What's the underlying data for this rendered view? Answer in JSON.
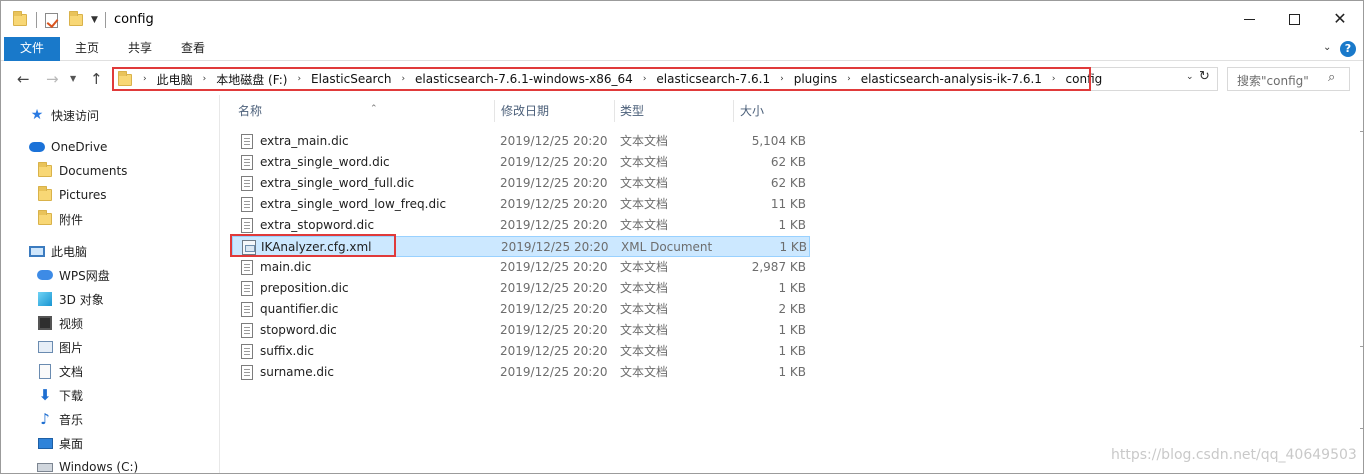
{
  "window": {
    "title": "config"
  },
  "ribbon": {
    "tabs": [
      {
        "label": "文件"
      },
      {
        "label": "主页"
      },
      {
        "label": "共享"
      },
      {
        "label": "查看"
      }
    ],
    "help": "?"
  },
  "address": {
    "breadcrumbs": [
      "此电脑",
      "本地磁盘 (F:)",
      "ElasticSearch",
      "elasticsearch-7.6.1-windows-x86_64",
      "elasticsearch-7.6.1",
      "plugins",
      "elasticsearch-analysis-ik-7.6.1",
      "config"
    ],
    "search_placeholder": "搜索\"config\""
  },
  "nav_pane": {
    "items": [
      {
        "label": "快速访问",
        "icon": "star-icon"
      },
      {
        "label": "OneDrive",
        "icon": "cloud-icon"
      },
      {
        "label": "Documents",
        "icon": "folder-icon"
      },
      {
        "label": "Pictures",
        "icon": "folder-icon"
      },
      {
        "label": "附件",
        "icon": "folder-icon"
      },
      {
        "label": "此电脑",
        "icon": "computer-icon"
      },
      {
        "label": "WPS网盘",
        "icon": "cloud-icon"
      },
      {
        "label": "3D 对象",
        "icon": "cube-icon"
      },
      {
        "label": "视频",
        "icon": "video-icon"
      },
      {
        "label": "图片",
        "icon": "picture-icon"
      },
      {
        "label": "文档",
        "icon": "document-icon"
      },
      {
        "label": "下载",
        "icon": "download-icon"
      },
      {
        "label": "音乐",
        "icon": "music-icon"
      },
      {
        "label": "桌面",
        "icon": "desktop-icon"
      },
      {
        "label": "Windows (C:)",
        "icon": "drive-icon"
      }
    ]
  },
  "columns": {
    "name": "名称",
    "date": "修改日期",
    "type": "类型",
    "size": "大小"
  },
  "files": [
    {
      "name": "extra_main.dic",
      "date": "2019/12/25 20:20",
      "type": "文本文档",
      "size": "5,104 KB"
    },
    {
      "name": "extra_single_word.dic",
      "date": "2019/12/25 20:20",
      "type": "文本文档",
      "size": "62 KB"
    },
    {
      "name": "extra_single_word_full.dic",
      "date": "2019/12/25 20:20",
      "type": "文本文档",
      "size": "62 KB"
    },
    {
      "name": "extra_single_word_low_freq.dic",
      "date": "2019/12/25 20:20",
      "type": "文本文档",
      "size": "11 KB"
    },
    {
      "name": "extra_stopword.dic",
      "date": "2019/12/25 20:20",
      "type": "文本文档",
      "size": "1 KB"
    },
    {
      "name": "IKAnalyzer.cfg.xml",
      "date": "2019/12/25 20:20",
      "type": "XML Document",
      "size": "1 KB",
      "selected": true
    },
    {
      "name": "main.dic",
      "date": "2019/12/25 20:20",
      "type": "文本文档",
      "size": "2,987 KB"
    },
    {
      "name": "preposition.dic",
      "date": "2019/12/25 20:20",
      "type": "文本文档",
      "size": "1 KB"
    },
    {
      "name": "quantifier.dic",
      "date": "2019/12/25 20:20",
      "type": "文本文档",
      "size": "2 KB"
    },
    {
      "name": "stopword.dic",
      "date": "2019/12/25 20:20",
      "type": "文本文档",
      "size": "1 KB"
    },
    {
      "name": "suffix.dic",
      "date": "2019/12/25 20:20",
      "type": "文本文档",
      "size": "1 KB"
    },
    {
      "name": "surname.dic",
      "date": "2019/12/25 20:20",
      "type": "文本文档",
      "size": "1 KB"
    }
  ],
  "watermark": "https://blog.csdn.net/qq_40649503",
  "colors": {
    "accent": "#1979ca",
    "selection": "#cce8ff",
    "highlight_box": "#e03a3a"
  }
}
